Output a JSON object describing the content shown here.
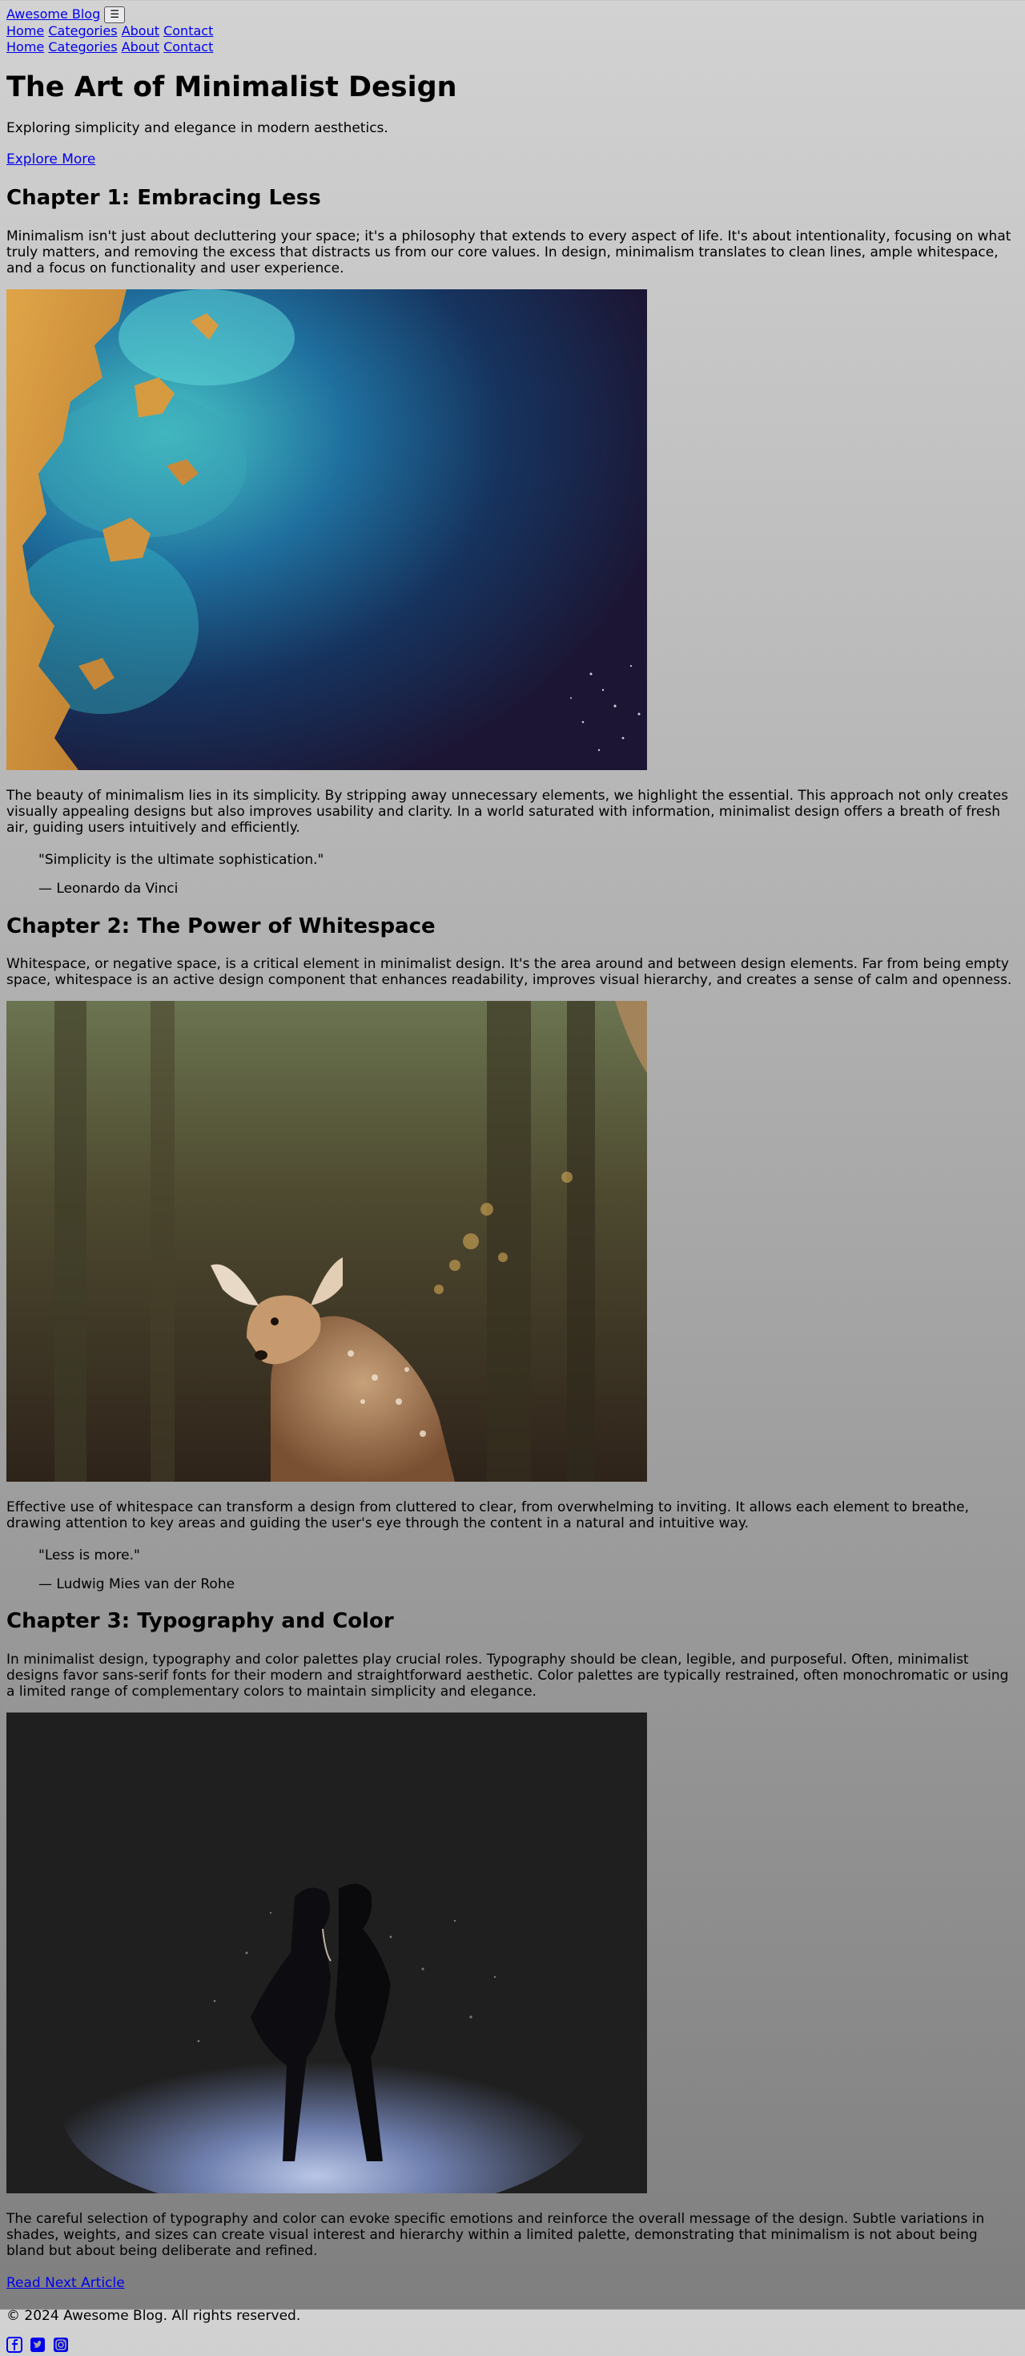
{
  "header": {
    "brand": "Awesome Blog",
    "menu_button_label": "☰",
    "nav_primary": [
      "Home",
      "Categories",
      "About",
      "Contact"
    ],
    "nav_secondary": [
      "Home",
      "Categories",
      "About",
      "Contact"
    ]
  },
  "hero": {
    "title": "The Art of Minimalist Design",
    "subtitle": "Exploring simplicity and elegance in modern aesthetics.",
    "cta": "Explore More"
  },
  "chapters": [
    {
      "title": "Chapter 1: Embracing Less",
      "intro": "Minimalism isn't just about decluttering your space; it's a philosophy that extends to every aspect of life. It's about intentionality, focusing on what truly matters, and removing the excess that distracts us from our core values. In design, minimalism translates to clean lines, ample whitespace, and a focus on functionality and user experience.",
      "image_alt": "aerial coastline",
      "body": "The beauty of minimalism lies in its simplicity. By stripping away unnecessary elements, we highlight the essential. This approach not only creates visually appealing designs but also improves usability and clarity. In a world saturated with information, minimalist design offers a breath of fresh air, guiding users intuitively and efficiently.",
      "quote": "\"Simplicity is the ultimate sophistication.\"",
      "quote_author": "— Leonardo da Vinci"
    },
    {
      "title": "Chapter 2: The Power of Whitespace",
      "intro": "Whitespace, or negative space, is a critical element in minimalist design. It's the area around and between design elements. Far from being empty space, whitespace is an active design component that enhances readability, improves visual hierarchy, and creates a sense of calm and openness.",
      "image_alt": "deer in forest",
      "body": "Effective use of whitespace can transform a design from cluttered to clear, from overwhelming to inviting. It allows each element to breathe, drawing attention to key areas and guiding the user's eye through the content in a natural and intuitive way.",
      "quote": "\"Less is more.\"",
      "quote_author": "— Ludwig Mies van der Rohe"
    },
    {
      "title": "Chapter 3: Typography and Color",
      "intro": "In minimalist design, typography and color palettes play crucial roles. Typography should be clean, legible, and purposeful. Often, minimalist designs favor sans-serif fonts for their modern and straightforward aesthetic. Color palettes are typically restrained, often monochromatic or using a limited range of complementary colors to maintain simplicity and elegance.",
      "image_alt": "couple silhouette in snow",
      "body": "The careful selection of typography and color can evoke specific emotions and reinforce the overall message of the design. Subtle variations in shades, weights, and sizes can create visual interest and hierarchy within a limited palette, demonstrating that minimalism is not about being bland but about being deliberate and refined."
    }
  ],
  "footer": {
    "next_link": "Read Next Article",
    "copyright": "© 2024 Awesome Blog. All rights reserved.",
    "social_icons": [
      "facebook-icon",
      "twitter-icon",
      "instagram-icon"
    ]
  },
  "colors": {
    "link": "#0000ee",
    "background_top": "#d2d2d2",
    "background_bottom": "#7f7f7f"
  }
}
